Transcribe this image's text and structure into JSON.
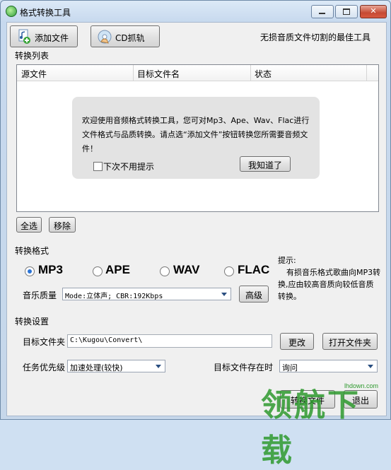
{
  "window": {
    "title": "格式转换工具"
  },
  "toolbar": {
    "add_file": "添加文件",
    "cd_grab": "CD抓轨",
    "slogan": "无损音质文件切割的最佳工具"
  },
  "convert_list": {
    "label": "转换列表",
    "columns": [
      "源文件",
      "目标文件名",
      "状态"
    ]
  },
  "welcome": {
    "message": "欢迎使用音频格式转换工具，您可对Mp3、Ape、Wav、Flac进行文件格式与品质转换。请点选“添加文件”按钮转换您所需要音频文件！",
    "dont_show": "下次不用提示",
    "got_it": "我知道了"
  },
  "list_actions": {
    "select_all": "全选",
    "remove": "移除"
  },
  "format": {
    "label": "转换格式",
    "options": [
      "MP3",
      "APE",
      "WAV",
      "FLAC"
    ],
    "selected": "MP3",
    "quality_label": "音乐质量",
    "quality_value": "Mode:立体声; CBR:192Kbps",
    "advanced": "高级"
  },
  "hint": {
    "title": "提示:",
    "text": "有损音乐格式歌曲向MP3转换,应由较高音质向较低音质转换。"
  },
  "settings": {
    "label": "转换设置",
    "target_folder_label": "目标文件夹",
    "target_folder_value": "C:\\Kugou\\Convert\\",
    "change": "更改",
    "open_folder": "打开文件夹",
    "priority_label": "任务优先级",
    "priority_value": "加速处理(较快)",
    "exists_label": "目标文件存在时",
    "exists_value": "询问"
  },
  "bottom": {
    "convert": "转换文件",
    "exit": "退出"
  },
  "watermark": {
    "text": "领航下载",
    "url": "lhdown.com"
  }
}
